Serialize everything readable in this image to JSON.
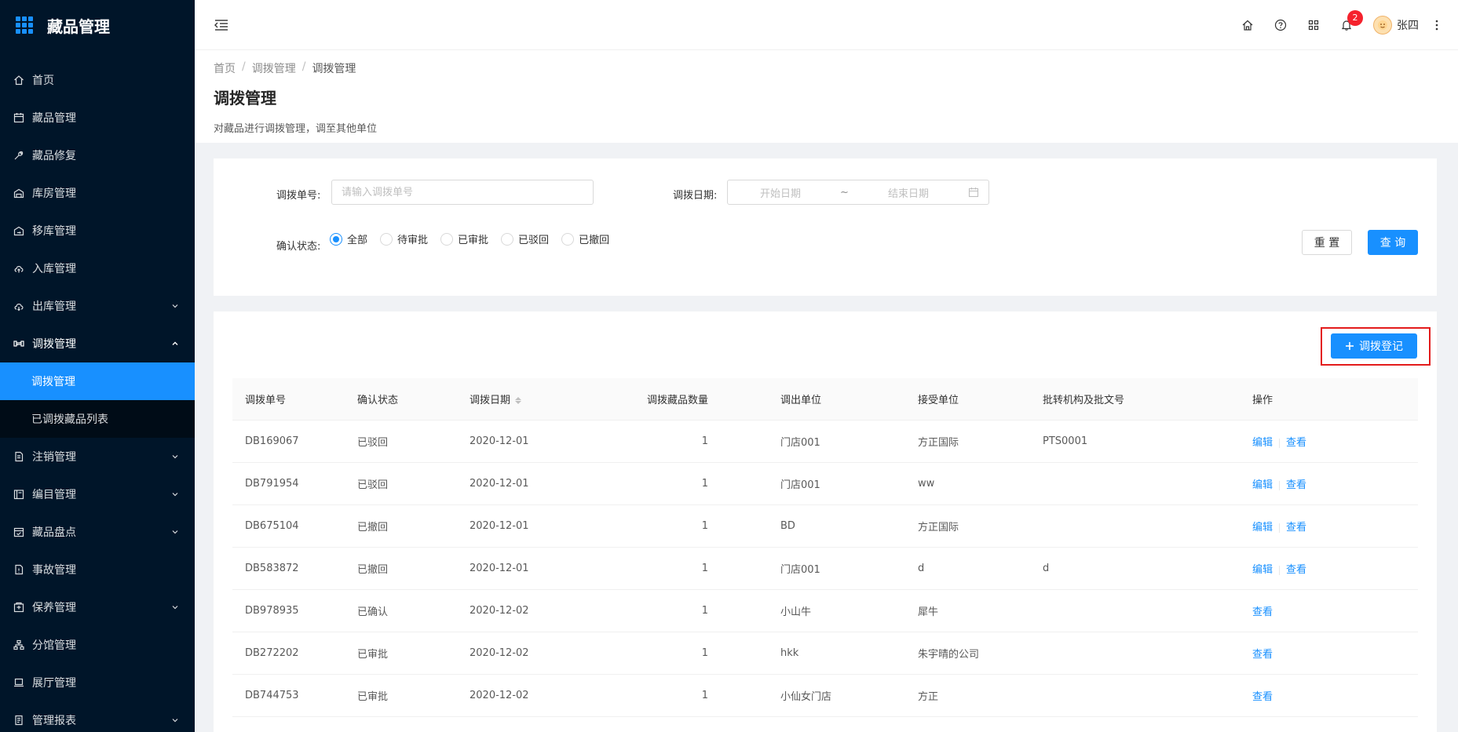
{
  "app": {
    "title": "藏品管理"
  },
  "sidebar": {
    "items": [
      {
        "label": "首页",
        "icon": "home-icon",
        "has_arrow": false
      },
      {
        "label": "藏品管理",
        "icon": "calendar-icon",
        "has_arrow": false
      },
      {
        "label": "藏品修复",
        "icon": "wrench-icon",
        "has_arrow": false
      },
      {
        "label": "库房管理",
        "icon": "warehouse-icon",
        "has_arrow": false
      },
      {
        "label": "移库管理",
        "icon": "move-icon",
        "has_arrow": false
      },
      {
        "label": "入库管理",
        "icon": "cloud-upload-icon",
        "has_arrow": false
      },
      {
        "label": "出库管理",
        "icon": "cloud-download-icon",
        "has_arrow": true
      },
      {
        "label": "调拨管理",
        "icon": "transfer-icon",
        "has_arrow": true,
        "open": true
      }
    ],
    "sub_items": [
      {
        "label": "调拨管理",
        "active": true
      },
      {
        "label": "已调拨藏品列表",
        "active": false
      }
    ],
    "items_after": [
      {
        "label": "注销管理",
        "icon": "file-icon",
        "has_arrow": true
      },
      {
        "label": "编目管理",
        "icon": "catalog-icon",
        "has_arrow": true
      },
      {
        "label": "藏品盘点",
        "icon": "calendar-check-icon",
        "has_arrow": true
      },
      {
        "label": "事故管理",
        "icon": "file-warning-icon",
        "has_arrow": false
      },
      {
        "label": "保养管理",
        "icon": "maintenance-icon",
        "has_arrow": true
      },
      {
        "label": "分馆管理",
        "icon": "org-icon",
        "has_arrow": false
      },
      {
        "label": "展厅管理",
        "icon": "laptop-icon",
        "has_arrow": false
      },
      {
        "label": "管理报表",
        "icon": "report-icon",
        "has_arrow": true
      }
    ]
  },
  "header": {
    "notification_count": "2",
    "user_name": "张四"
  },
  "breadcrumb": [
    "首页",
    "调拨管理",
    "调拨管理"
  ],
  "page": {
    "title": "调拨管理",
    "description": "对藏品进行调拨管理，调至其他单位"
  },
  "filter": {
    "order_no_label": "调拨单号:",
    "order_no_placeholder": "请输入调拨单号",
    "date_label": "调拨日期:",
    "date_start_placeholder": "开始日期",
    "date_separator": "~",
    "date_end_placeholder": "结束日期",
    "status_label": "确认状态:",
    "status_options": [
      "全部",
      "待审批",
      "已审批",
      "已驳回",
      "已撤回"
    ],
    "status_selected": "全部",
    "reset_label": "重 置",
    "query_label": "查 询"
  },
  "table": {
    "add_button_label": "调拨登记",
    "columns": [
      "调拨单号",
      "确认状态",
      "调拨日期",
      "调拨藏品数量",
      "调出单位",
      "接受单位",
      "批转机构及批文号",
      "操作"
    ],
    "rows": [
      {
        "no": "DB169067",
        "status": "已驳回",
        "date": "2020-12-01",
        "count": "1",
        "from": "门店001",
        "to": "方正国际",
        "approval": "PTS0001",
        "actions": [
          "编辑",
          "查看"
        ]
      },
      {
        "no": "DB791954",
        "status": "已驳回",
        "date": "2020-12-01",
        "count": "1",
        "from": "门店001",
        "to": "ww",
        "approval": "",
        "actions": [
          "编辑",
          "查看"
        ]
      },
      {
        "no": "DB675104",
        "status": "已撤回",
        "date": "2020-12-01",
        "count": "1",
        "from": "BD",
        "to": "方正国际",
        "approval": "",
        "actions": [
          "编辑",
          "查看"
        ]
      },
      {
        "no": "DB583872",
        "status": "已撤回",
        "date": "2020-12-01",
        "count": "1",
        "from": "门店001",
        "to": "d",
        "approval": "d",
        "actions": [
          "编辑",
          "查看"
        ]
      },
      {
        "no": "DB978935",
        "status": "已确认",
        "date": "2020-12-02",
        "count": "1",
        "from": "小山牛",
        "to": "犀牛",
        "approval": "",
        "actions": [
          "查看"
        ]
      },
      {
        "no": "DB272202",
        "status": "已审批",
        "date": "2020-12-02",
        "count": "1",
        "from": "hkk",
        "to": "朱宇晴的公司",
        "approval": "",
        "actions": [
          "查看"
        ]
      },
      {
        "no": "DB744753",
        "status": "已审批",
        "date": "2020-12-02",
        "count": "1",
        "from": "小仙女门店",
        "to": "方正",
        "approval": "",
        "actions": [
          "查看"
        ]
      }
    ]
  },
  "colors": {
    "primary": "#1890ff",
    "sidebar_bg": "#001529",
    "highlight_border": "#e31b1b",
    "badge": "#f5222d"
  }
}
